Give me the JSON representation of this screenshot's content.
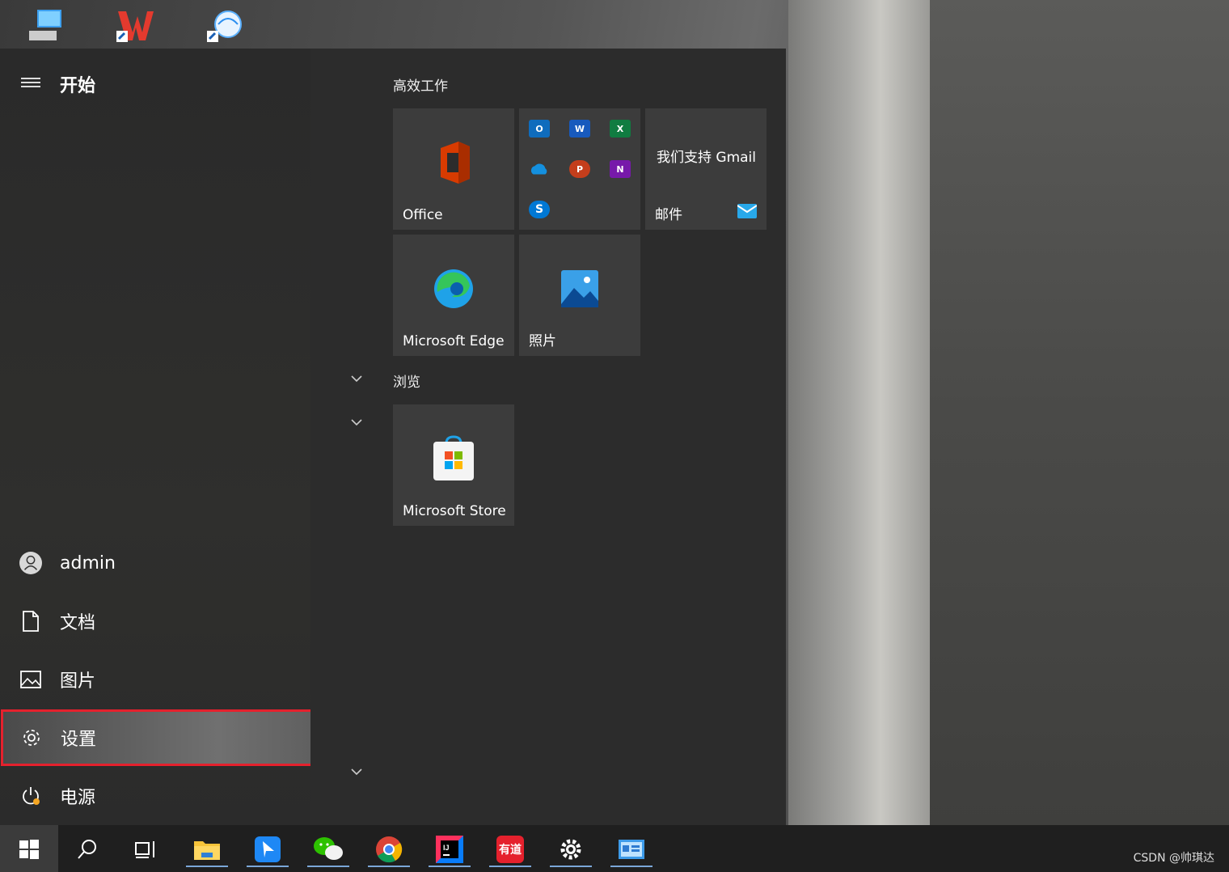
{
  "start": {
    "title": "开始",
    "nav": {
      "user": "admin",
      "documents": "文档",
      "pictures": "图片",
      "settings": "设置",
      "power": "电源"
    }
  },
  "groups": {
    "productivity": "高效工作",
    "browse": "浏览"
  },
  "tiles": {
    "office": "Office",
    "gmail_line": "我们支持 Gmail",
    "mail": "邮件",
    "edge": "Microsoft Edge",
    "photos": "照片",
    "store": "Microsoft Store"
  },
  "office_apps": {
    "outlook": "O",
    "word": "W",
    "excel": "X",
    "powerpoint": "P",
    "onenote": "N",
    "skype": "S"
  },
  "taskbar": {
    "youdao": "有道"
  },
  "watermark": "CSDN @帅琪达",
  "colors": {
    "highlight_border": "#e5212d",
    "accent_blue": "#0078d4"
  }
}
